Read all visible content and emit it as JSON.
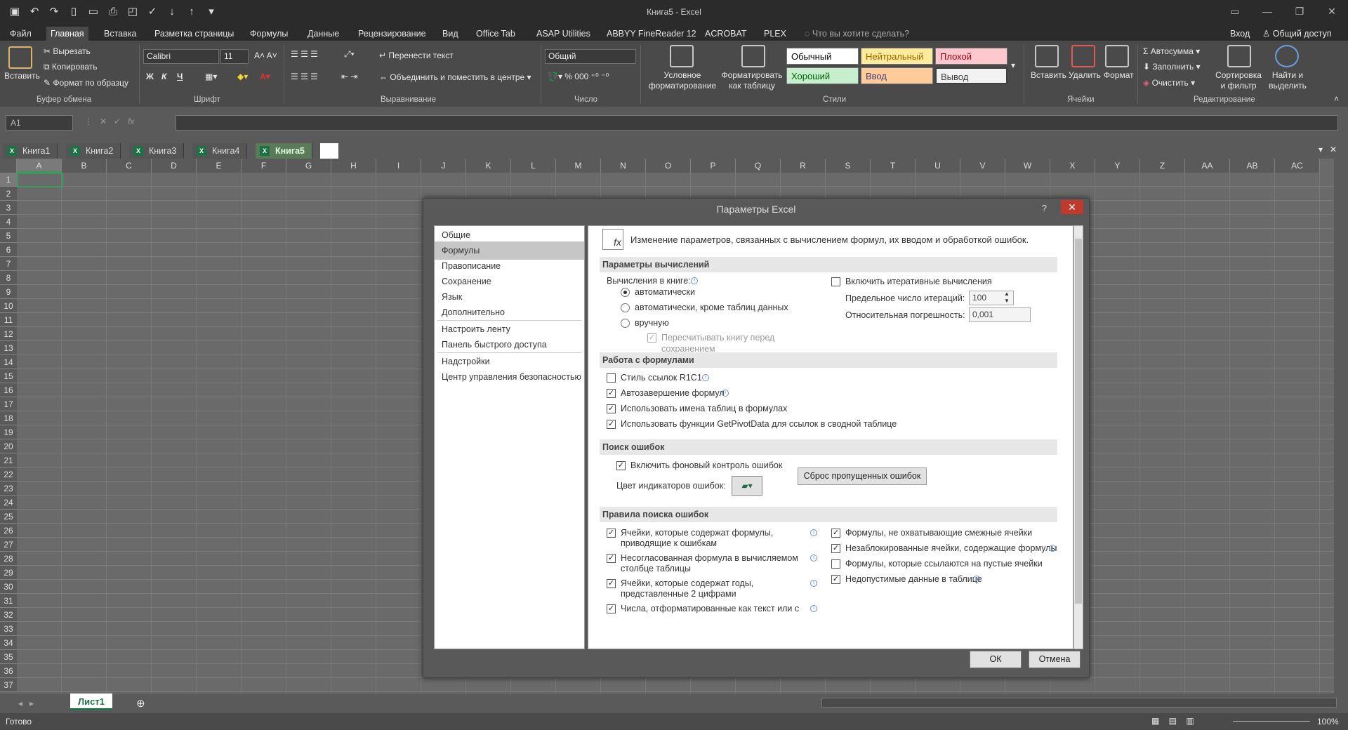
{
  "window": {
    "title": "Книга5 - Excel"
  },
  "ribbon_tabs": [
    "Файл",
    "Главная",
    "Вставка",
    "Разметка страницы",
    "Формулы",
    "Данные",
    "Рецензирование",
    "Вид",
    "Office Tab",
    "ASAP Utilities",
    "ABBYY FineReader 12",
    "ACROBAT",
    "PLEX"
  ],
  "tell_me": "Что вы хотите сделать?",
  "signin": "Вход",
  "share": "Общий доступ",
  "clipboard": {
    "paste": "Вставить",
    "cut": "Вырезать",
    "copy": "Копировать",
    "format_painter": "Формат по образцу",
    "label": "Буфер обмена"
  },
  "font": {
    "name": "Calibri",
    "size": "11",
    "label": "Шрифт",
    "bold": "Ж",
    "italic": "К",
    "underline": "Ч"
  },
  "alignment": {
    "wrap": "Перенести текст",
    "merge": "Объединить и поместить в центре",
    "label": "Выравнивание"
  },
  "number": {
    "format": "Общий",
    "label": "Число"
  },
  "styles": {
    "conditional": "Условное форматирование",
    "as_table": "Форматировать как таблицу",
    "normal": "Обычный",
    "neutral": "Нейтральный",
    "bad": "Плохой",
    "good": "Хороший",
    "input": "Ввод",
    "output": "Вывод",
    "label": "Стили"
  },
  "cells": {
    "insert": "Вставить",
    "delete": "Удалить",
    "format": "Формат",
    "label": "Ячейки"
  },
  "editing": {
    "autosum": "Автосумма",
    "fill": "Заполнить",
    "clear": "Очистить",
    "sort": "Сортировка и фильтр",
    "find": "Найти и выделить",
    "label": "Редактирование"
  },
  "name_box": "A1",
  "doc_tabs": [
    "Книга1",
    "Книга2",
    "Книга3",
    "Книга4",
    "Книга5"
  ],
  "columns": [
    "A",
    "B",
    "C",
    "D",
    "E",
    "F",
    "G",
    "H",
    "I",
    "J",
    "K",
    "L",
    "M",
    "N",
    "O",
    "P",
    "Q",
    "R",
    "S",
    "T",
    "U",
    "V",
    "W",
    "X",
    "Y",
    "Z",
    "AA",
    "AB",
    "AC"
  ],
  "rows": [
    "1",
    "2",
    "3",
    "4",
    "5",
    "6",
    "7",
    "8",
    "9",
    "10",
    "11",
    "12",
    "13",
    "14",
    "15",
    "16",
    "17",
    "18",
    "19",
    "20",
    "21",
    "22",
    "23",
    "24",
    "25",
    "26",
    "27",
    "28",
    "29",
    "30",
    "31",
    "32",
    "33",
    "34",
    "35",
    "36",
    "37"
  ],
  "sheet_tab": "Лист1",
  "status": {
    "ready": "Готово",
    "zoom": "100%"
  },
  "dialog": {
    "title": "Параметры Excel",
    "help": "?",
    "nav": [
      "Общие",
      "Формулы",
      "Правописание",
      "Сохранение",
      "Язык",
      "Дополнительно",
      "Настроить ленту",
      "Панель быстрого доступа",
      "Надстройки",
      "Центр управления безопасностью"
    ],
    "intro": "Изменение параметров, связанных с вычислением формул, их вводом и обработкой ошибок.",
    "calc": {
      "header": "Параметры вычислений",
      "workbook_calc": "Вычисления в книге:",
      "auto": "автоматически",
      "auto_except": "автоматически, кроме таблиц данных",
      "manual": "вручную",
      "recalc_line1": "Пересчитывать книгу перед",
      "recalc_line2": "сохранением",
      "iterative": "Включить итеративные вычисления",
      "max_iter_label": "Предельное число итераций:",
      "max_iter": "100",
      "max_change_label": "Относительная погрешность:",
      "max_change": "0,001"
    },
    "formulas": {
      "header": "Работа с формулами",
      "r1c1": "Стиль ссылок R1C1",
      "autocomplete": "Автозавершение формул",
      "table_names": "Использовать имена таблиц в формулах",
      "getpivot": "Использовать функции GetPivotData для ссылок в сводной таблице"
    },
    "errors": {
      "header": "Поиск ошибок",
      "background": "Включить фоновый контроль ошибок",
      "indicator_color": "Цвет индикаторов ошибок:",
      "reset": "Сброс пропущенных ошибок"
    },
    "rules": {
      "header": "Правила поиска ошибок",
      "left": [
        {
          "l1": "Ячейки, которые содержат формулы,",
          "l2": "приводящие к ошибкам"
        },
        {
          "l1": "Несогласованная формула в вычисляемом",
          "l2": "столбце таблицы"
        },
        {
          "l1": "Ячейки, которые содержат годы,",
          "l2": "представленные 2 цифрами"
        },
        {
          "l1": "Числа, отформатированные как текст или с",
          "l2": ""
        }
      ],
      "right": [
        "Формулы, не охватывающие смежные ячейки",
        "Незаблокированные ячейки, содержащие формулы",
        "Формулы, которые ссылаются на пустые ячейки",
        "Недопустимые данные в таблице"
      ]
    },
    "ok": "ОК",
    "cancel": "Отмена"
  }
}
